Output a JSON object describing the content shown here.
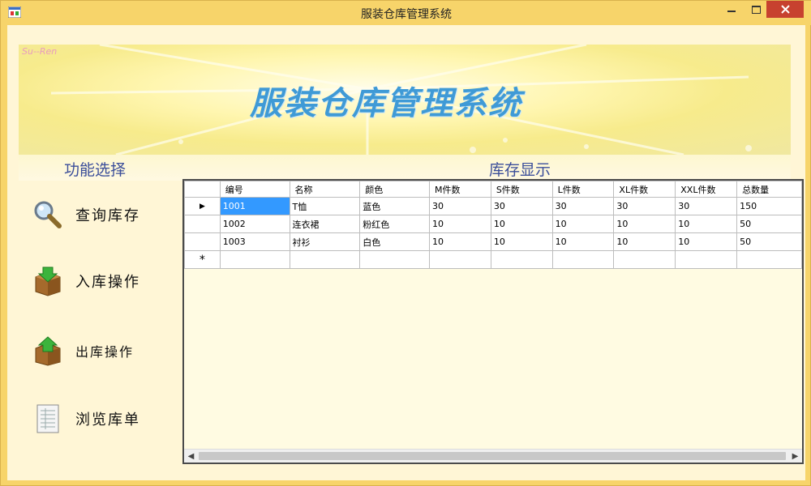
{
  "window": {
    "title": "服装仓库管理系统"
  },
  "banner": {
    "title": "服装仓库管理系统",
    "logo_text": "Su--Ren"
  },
  "labels": {
    "function_select": "功能选择",
    "stock_display": "库存显示"
  },
  "nav": [
    {
      "label": "查询库存",
      "icon": "magnifier-icon"
    },
    {
      "label": "入库操作",
      "icon": "box-in-icon"
    },
    {
      "label": "出库操作",
      "icon": "box-out-icon"
    },
    {
      "label": "浏览库单",
      "icon": "document-list-icon"
    }
  ],
  "grid": {
    "columns": [
      "编号",
      "名称",
      "颜色",
      "M件数",
      "S件数",
      "L件数",
      "XL件数",
      "XXL件数",
      "总数量"
    ],
    "rows": [
      [
        "1001",
        "T恤",
        "蓝色",
        "30",
        "30",
        "30",
        "30",
        "30",
        "150"
      ],
      [
        "1002",
        "连衣裙",
        "粉红色",
        "10",
        "10",
        "10",
        "10",
        "10",
        "50"
      ],
      [
        "1003",
        "衬衫",
        "白色",
        "10",
        "10",
        "10",
        "10",
        "10",
        "50"
      ]
    ],
    "current_row_marker": "▶",
    "new_row_marker": "*"
  },
  "colors": {
    "frame": "#f7d46a",
    "close": "#c7412f",
    "selected": "#3399ff",
    "label": "#3b4e9a",
    "banner_title": "#3f9ad6"
  }
}
